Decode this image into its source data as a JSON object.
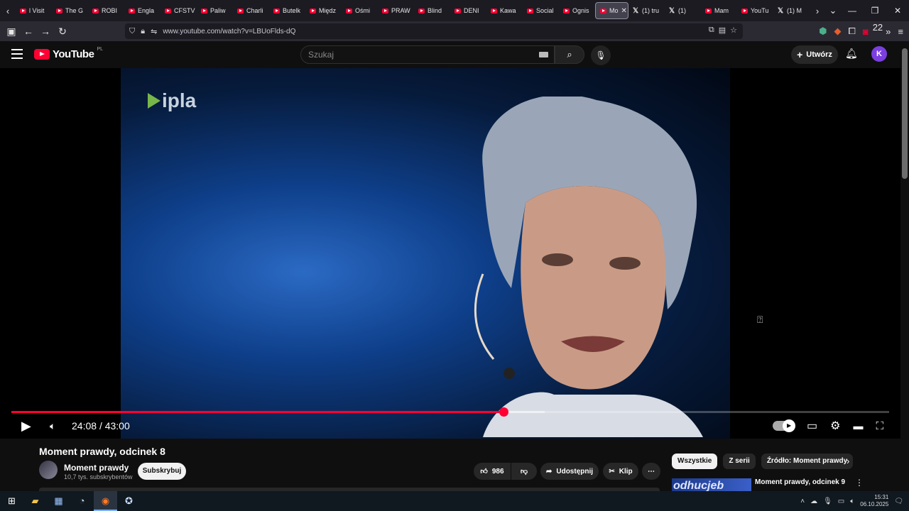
{
  "browser": {
    "tabs": [
      {
        "label": "l Visit",
        "icon": "youtube-favicon"
      },
      {
        "label": "The G",
        "icon": "youtube-favicon"
      },
      {
        "label": "ROBI",
        "icon": "youtube-favicon"
      },
      {
        "label": "Engla",
        "icon": "youtube-favicon"
      },
      {
        "label": "CFSTV",
        "icon": "youtube-favicon"
      },
      {
        "label": "Paliw",
        "icon": "youtube-favicon"
      },
      {
        "label": "Charli",
        "icon": "youtube-favicon"
      },
      {
        "label": "Butelk",
        "icon": "youtube-favicon"
      },
      {
        "label": "Międz",
        "icon": "youtube-favicon"
      },
      {
        "label": "Ośmi",
        "icon": "youtube-favicon"
      },
      {
        "label": "PRAW",
        "icon": "youtube-favicon"
      },
      {
        "label": "Blind",
        "icon": "youtube-favicon"
      },
      {
        "label": "DENI",
        "icon": "youtube-favicon"
      },
      {
        "label": "Kawa",
        "icon": "youtube-favicon"
      },
      {
        "label": "Social",
        "icon": "youtube-favicon"
      },
      {
        "label": "Ognis",
        "icon": "youtube-favicon"
      },
      {
        "label": "Mo",
        "icon": "youtube-favicon",
        "active": true
      },
      {
        "label": "(1) tru",
        "icon": "x-favicon"
      },
      {
        "label": "(1)",
        "icon": "x-favicon"
      },
      {
        "label": "Mam",
        "icon": "youtube-favicon"
      },
      {
        "label": "YouTu",
        "icon": "youtube-favicon"
      },
      {
        "label": "(1) M",
        "icon": "x-favicon"
      }
    ],
    "url": "www.youtube.com/watch?v=LBUoFlds-dQ",
    "extensions_badge": "22"
  },
  "youtube": {
    "logo_text": "YouTube",
    "country_code": "PL",
    "search_placeholder": "Szukaj",
    "create_label": "Utwórz",
    "avatar_letter": "K"
  },
  "player": {
    "watermark": "ipla",
    "current_time": "24:08",
    "duration": "43:00",
    "progress_fraction": 0.561,
    "buffered_fraction": 0.608,
    "accent_color": "#ff0033"
  },
  "video": {
    "title": "Moment prawdy, odcinek 8",
    "channel": "Moment prawdy",
    "subscribers": "10,7 tys. subskrybentów",
    "subscribe_label": "Subskrybuj",
    "likes": "986",
    "share_label": "Udostępnij",
    "clip_label": "Klip"
  },
  "sidebar": {
    "chips": [
      {
        "label": "Wszystkie",
        "selected": true
      },
      {
        "label": "Z serii",
        "selected": false
      },
      {
        "label": "Źródło: Moment prawdy",
        "selected": false
      }
    ],
    "rec_title": "Moment prawdy, odcinek 9",
    "rec_thumb_text": "odhucjeb"
  },
  "taskbar": {
    "time": "15:31",
    "date": "06.10.2025"
  }
}
